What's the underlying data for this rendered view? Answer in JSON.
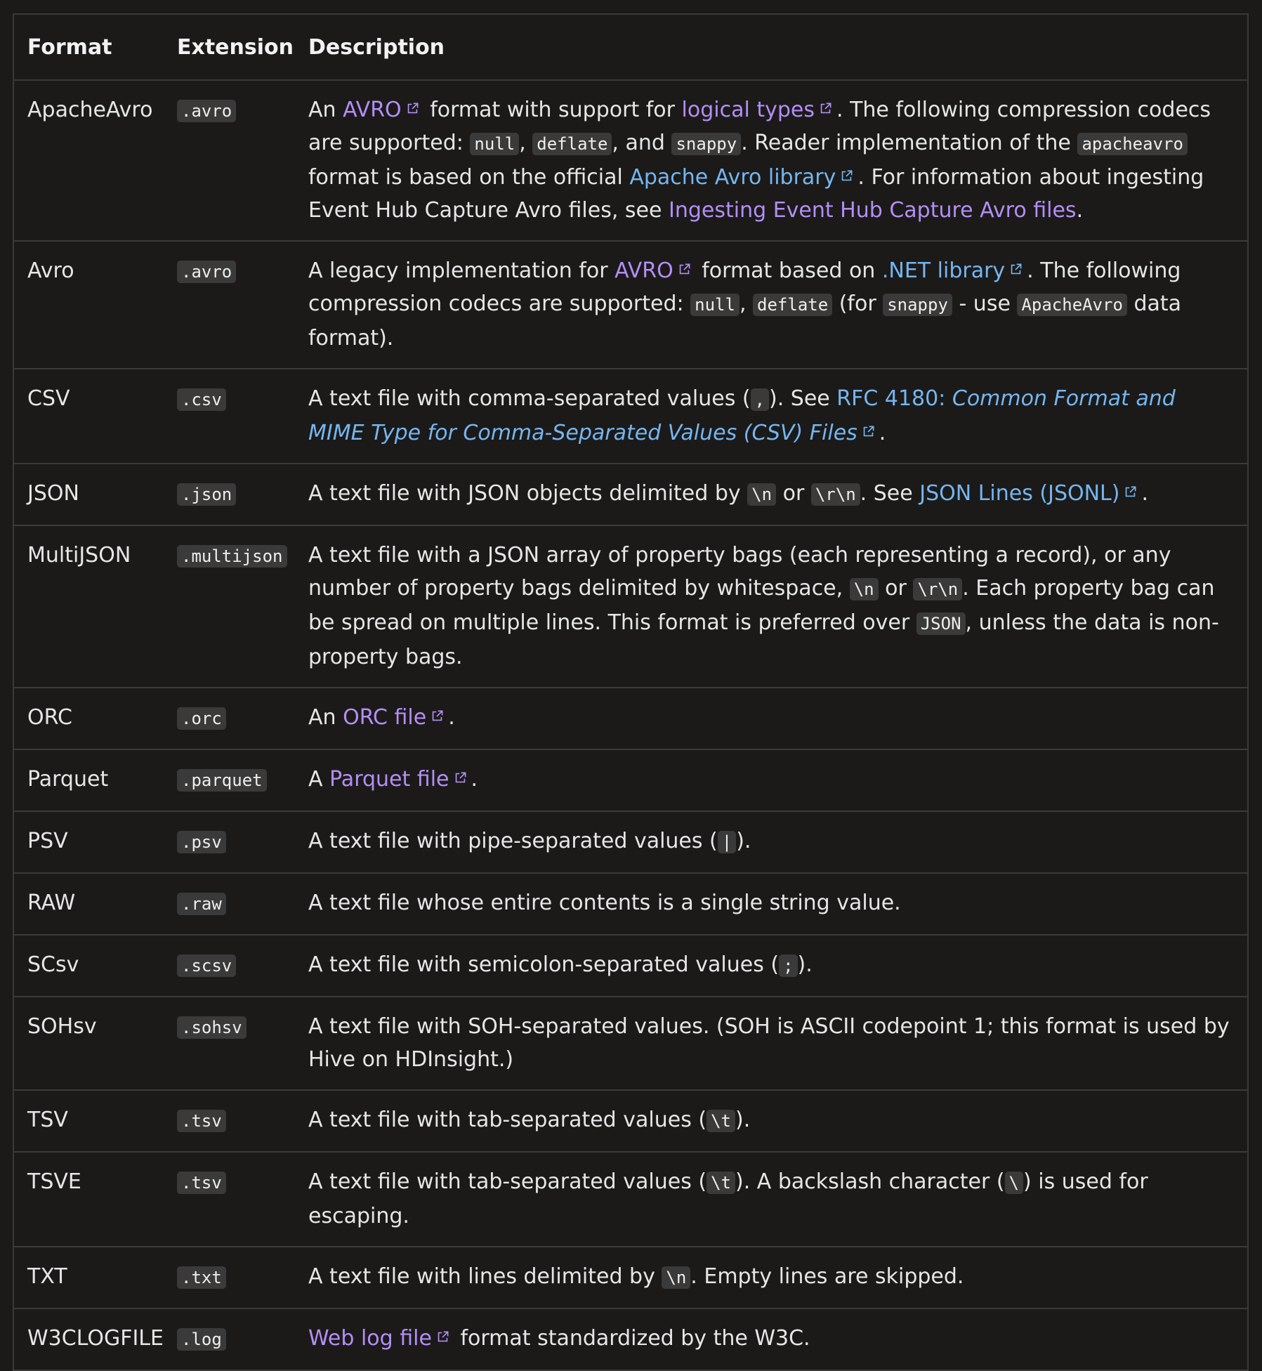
{
  "table": {
    "headers": {
      "format": "Format",
      "extension": "Extension",
      "description": "Description"
    },
    "rows": [
      {
        "format": "ApacheAvro",
        "extension": ".avro",
        "description": [
          {
            "t": "text",
            "v": "An "
          },
          {
            "t": "link",
            "v": "AVRO",
            "ext": true
          },
          {
            "t": "text",
            "v": " format with support for "
          },
          {
            "t": "link",
            "v": "logical types",
            "ext": true
          },
          {
            "t": "text",
            "v": ". The following compression codecs are supported: "
          },
          {
            "t": "code",
            "v": "null"
          },
          {
            "t": "text",
            "v": ", "
          },
          {
            "t": "code",
            "v": "deflate"
          },
          {
            "t": "text",
            "v": ", and "
          },
          {
            "t": "code",
            "v": "snappy"
          },
          {
            "t": "text",
            "v": ". Reader implementation of the "
          },
          {
            "t": "code",
            "v": "apacheavro"
          },
          {
            "t": "text",
            "v": " format is based on the official "
          },
          {
            "t": "link",
            "v": "Apache Avro library",
            "ext": true,
            "blue": true
          },
          {
            "t": "text",
            "v": ". For information about ingesting Event Hub Capture Avro files, see "
          },
          {
            "t": "link",
            "v": "Ingesting Event Hub Capture Avro files"
          },
          {
            "t": "text",
            "v": "."
          }
        ]
      },
      {
        "format": "Avro",
        "extension": ".avro",
        "description": [
          {
            "t": "text",
            "v": "A legacy implementation for "
          },
          {
            "t": "link",
            "v": "AVRO",
            "ext": true
          },
          {
            "t": "text",
            "v": " format based on "
          },
          {
            "t": "link",
            "v": ".NET library",
            "ext": true,
            "blue": true
          },
          {
            "t": "text",
            "v": ". The following compression codecs are supported: "
          },
          {
            "t": "code",
            "v": "null"
          },
          {
            "t": "text",
            "v": ", "
          },
          {
            "t": "code",
            "v": "deflate"
          },
          {
            "t": "text",
            "v": " (for "
          },
          {
            "t": "code",
            "v": "snappy"
          },
          {
            "t": "text",
            "v": " - use "
          },
          {
            "t": "code",
            "v": "ApacheAvro"
          },
          {
            "t": "text",
            "v": " data format)."
          }
        ]
      },
      {
        "format": "CSV",
        "extension": ".csv",
        "description": [
          {
            "t": "text",
            "v": "A text file with comma-separated values ("
          },
          {
            "t": "code",
            "v": ","
          },
          {
            "t": "text",
            "v": "). See "
          },
          {
            "t": "link",
            "v": "RFC 4180: ",
            "blue": true
          },
          {
            "t": "link",
            "v": "Common Format and MIME Type for Comma-Separated Values (CSV) Files",
            "ext": true,
            "blue": true,
            "italic": true
          },
          {
            "t": "text",
            "v": "."
          }
        ]
      },
      {
        "format": "JSON",
        "extension": ".json",
        "description": [
          {
            "t": "text",
            "v": "A text file with JSON objects delimited by "
          },
          {
            "t": "code",
            "v": "\\n"
          },
          {
            "t": "text",
            "v": " or "
          },
          {
            "t": "code",
            "v": "\\r\\n"
          },
          {
            "t": "text",
            "v": ". See "
          },
          {
            "t": "link",
            "v": "JSON Lines (JSONL)",
            "ext": true,
            "blue": true
          },
          {
            "t": "text",
            "v": "."
          }
        ]
      },
      {
        "format": "MultiJSON",
        "extension": ".multijson",
        "description": [
          {
            "t": "text",
            "v": "A text file with a JSON array of property bags (each representing a record), or any number of property bags delimited by whitespace, "
          },
          {
            "t": "code",
            "v": "\\n"
          },
          {
            "t": "text",
            "v": " or "
          },
          {
            "t": "code",
            "v": "\\r\\n"
          },
          {
            "t": "text",
            "v": ". Each property bag can be spread on multiple lines. This format is preferred over "
          },
          {
            "t": "code",
            "v": "JSON"
          },
          {
            "t": "text",
            "v": ", unless the data is non-property bags."
          }
        ]
      },
      {
        "format": "ORC",
        "extension": ".orc",
        "description": [
          {
            "t": "text",
            "v": "An "
          },
          {
            "t": "link",
            "v": "ORC file",
            "ext": true
          },
          {
            "t": "text",
            "v": "."
          }
        ]
      },
      {
        "format": "Parquet",
        "extension": ".parquet",
        "description": [
          {
            "t": "text",
            "v": "A "
          },
          {
            "t": "link",
            "v": "Parquet file",
            "ext": true
          },
          {
            "t": "text",
            "v": "."
          }
        ]
      },
      {
        "format": "PSV",
        "extension": ".psv",
        "description": [
          {
            "t": "text",
            "v": "A text file with pipe-separated values ("
          },
          {
            "t": "code",
            "v": "|"
          },
          {
            "t": "text",
            "v": ")."
          }
        ]
      },
      {
        "format": "RAW",
        "extension": ".raw",
        "description": [
          {
            "t": "text",
            "v": "A text file whose entire contents is a single string value."
          }
        ]
      },
      {
        "format": "SCsv",
        "extension": ".scsv",
        "description": [
          {
            "t": "text",
            "v": "A text file with semicolon-separated values ("
          },
          {
            "t": "code",
            "v": ";"
          },
          {
            "t": "text",
            "v": ")."
          }
        ]
      },
      {
        "format": "SOHsv",
        "extension": ".sohsv",
        "description": [
          {
            "t": "text",
            "v": "A text file with SOH-separated values. (SOH is ASCII codepoint 1; this format is used by Hive on HDInsight.)"
          }
        ]
      },
      {
        "format": "TSV",
        "extension": ".tsv",
        "description": [
          {
            "t": "text",
            "v": "A text file with tab-separated values ("
          },
          {
            "t": "code",
            "v": "\\t"
          },
          {
            "t": "text",
            "v": ")."
          }
        ]
      },
      {
        "format": "TSVE",
        "extension": ".tsv",
        "description": [
          {
            "t": "text",
            "v": "A text file with tab-separated values ("
          },
          {
            "t": "code",
            "v": "\\t"
          },
          {
            "t": "text",
            "v": "). A backslash character ("
          },
          {
            "t": "code",
            "v": "\\"
          },
          {
            "t": "text",
            "v": ") is used for escaping."
          }
        ]
      },
      {
        "format": "TXT",
        "extension": ".txt",
        "description": [
          {
            "t": "text",
            "v": "A text file with lines delimited by "
          },
          {
            "t": "code",
            "v": "\\n"
          },
          {
            "t": "text",
            "v": ". Empty lines are skipped."
          }
        ]
      },
      {
        "format": "W3CLOGFILE",
        "extension": ".log",
        "description": [
          {
            "t": "link",
            "v": "Web log file",
            "ext": true
          },
          {
            "t": "text",
            "v": " format standardized by the W3C."
          }
        ]
      }
    ]
  },
  "colors": {
    "background": "#1b1a19",
    "border": "#3b3a39",
    "text": "#e6e6e6",
    "link_purple": "#b48ef5",
    "link_blue": "#75b6f0",
    "code_bg": "#3a3a3a"
  },
  "icons": {
    "external_link": "external-link-icon"
  }
}
